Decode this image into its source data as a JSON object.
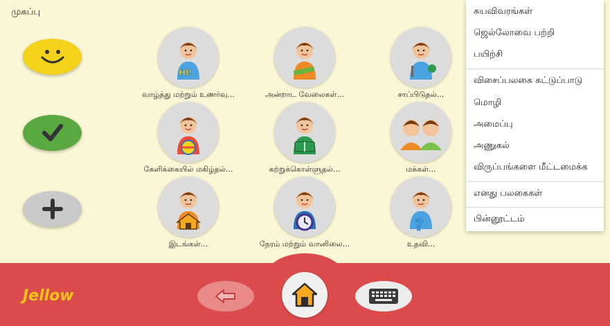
{
  "header": {
    "title": "முகப்பு"
  },
  "side_buttons": [
    {
      "name": "like-button",
      "icon": "smiley-icon",
      "color": "#f4d21b"
    },
    {
      "name": "yes-button",
      "icon": "checkmark-icon",
      "color": "#5aa940"
    },
    {
      "name": "more-button",
      "icon": "plus-icon",
      "color": "#c9c9c9"
    }
  ],
  "tiles": [
    {
      "label": "வாழ்த்து மற்றும் உணர்வு...",
      "icon": "greeting-boy-icon"
    },
    {
      "label": "அன்றாட வேலைகள்...",
      "icon": "daily-activities-boy-icon"
    },
    {
      "label": "சாப்பிடுதல்...",
      "icon": "eating-boy-icon"
    },
    {
      "label": "கேளிக்கையில் மகிழ்தல்...",
      "icon": "fun-boy-ball-icon"
    },
    {
      "label": "கற்றுக்கொள்ளுதல்...",
      "icon": "learning-boy-book-icon"
    },
    {
      "label": "மக்கள்...",
      "icon": "people-two-kids-icon"
    },
    {
      "label": "இடங்கள்...",
      "icon": "places-boy-house-icon"
    },
    {
      "label": "நேரம் மற்றும் வானிலை...",
      "icon": "time-boy-clock-icon"
    },
    {
      "label": "உதவி...",
      "icon": "help-boy-question-icon"
    }
  ],
  "menu": {
    "items": [
      "சுயவிவரங்கள்",
      "ஜெல்லோவை பற்றி",
      "பயிற்சி",
      "விசைப்பலகை கட்டுப்பாடு",
      "மொழி",
      "அமைப்பு",
      "அணுகல்",
      "விருப்பங்களை மீட்டமைக்க",
      "எனது பலகைகள்",
      "பின்னூட்டம்"
    ]
  },
  "bottom": {
    "logo": "Jellow",
    "back_icon": "back-arrow-icon",
    "home_icon": "home-icon",
    "keyboard_icon": "keyboard-icon"
  },
  "colors": {
    "background": "#fbf6d6",
    "bottom_bar": "#dc4b4b",
    "logo": "#f6c31b"
  }
}
